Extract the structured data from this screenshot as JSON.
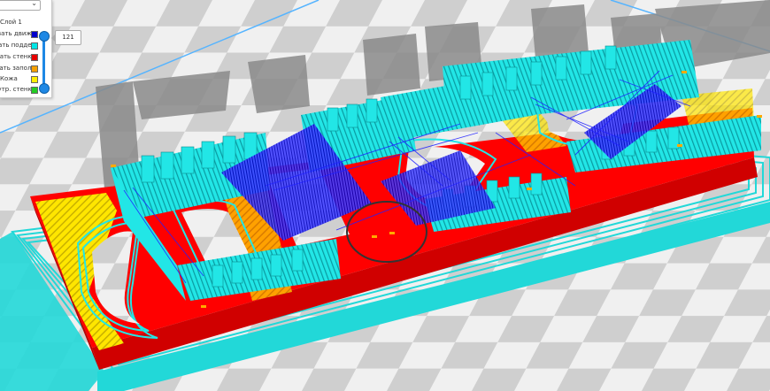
{
  "legend": {
    "view_selected": "",
    "items": [
      {
        "label": "Слой 1",
        "color": ""
      },
      {
        "label": "Показать движе...",
        "color": "#0000cc"
      },
      {
        "label": "Показать поддер...",
        "color": "#00e6e6"
      },
      {
        "label": "Показать стенки",
        "color": "#e60000"
      },
      {
        "label": "Показать заполн...",
        "color": "#f5a000"
      },
      {
        "label": "Кожа",
        "color": "#ffee00"
      },
      {
        "label": "Внутр. стенка",
        "color": "#22cc22"
      }
    ]
  },
  "layer_slider": {
    "value": "121",
    "upper_level": 0.95,
    "lower_level": 0.0
  },
  "colors": {
    "wall": "#ff0000",
    "support": "#22e6e6",
    "travel": "#1010ee",
    "skin": "#ffe600",
    "ghost": "#8a8a8a",
    "plate_light": "#f2f2f2",
    "plate_dark": "#d0d0d0",
    "build_edge": "#55b4ff"
  }
}
